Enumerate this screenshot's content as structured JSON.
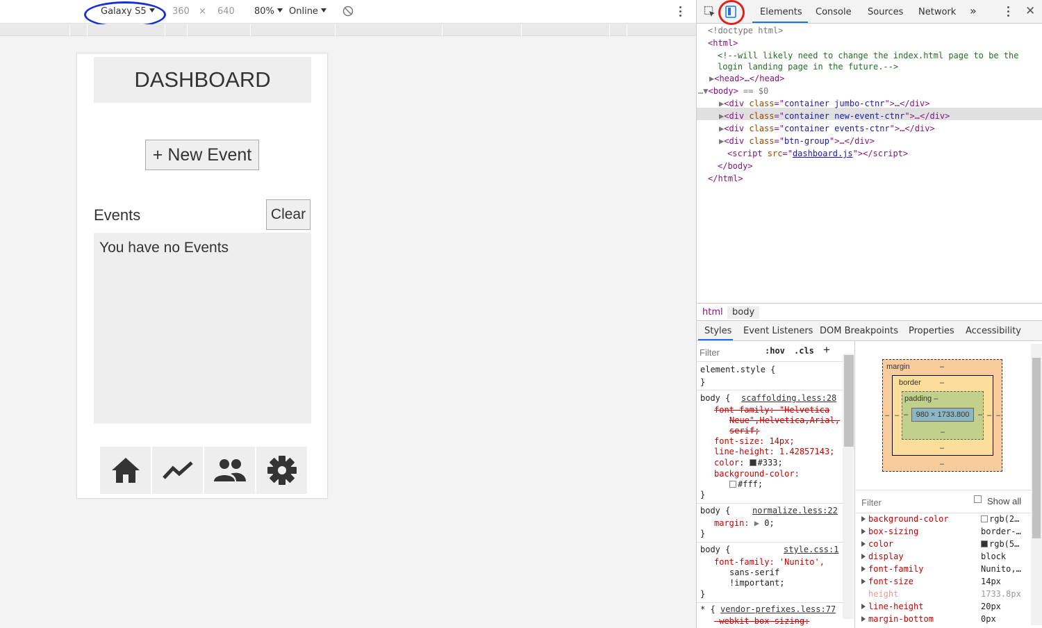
{
  "device_toolbar": {
    "device_name": "Galaxy S5",
    "width": "360",
    "times": "×",
    "height": "640",
    "zoom": "80%",
    "network": "Online"
  },
  "page": {
    "title": "DASHBOARD",
    "new_event_label": "+ New Event",
    "events_label": "Events",
    "clear_label": "Clear",
    "empty_message": "You have no Events"
  },
  "devtools": {
    "tabs": [
      "Elements",
      "Console",
      "Sources",
      "Network"
    ],
    "more": "»",
    "dom": {
      "doctype": "<!doctype html>",
      "html_open": "<html>",
      "comment_1": "<!--will likely need to change the index.html page to be the",
      "comment_2": "login landing page in the future.-->",
      "head": "<head>…</head>",
      "body_open": "<body>",
      "body_eq": " == $0",
      "divs": [
        {
          "class": "container jumbo-ctnr"
        },
        {
          "class": "container new-event-ctnr"
        },
        {
          "class": "container events-ctnr"
        },
        {
          "class": "btn-group"
        }
      ],
      "script_src": "dashboard.js",
      "body_close": "</body>",
      "html_close": "</html>"
    },
    "breadcrumbs": [
      "html",
      "body"
    ],
    "sub_tabs": [
      "Styles",
      "Event Listeners",
      "DOM Breakpoints",
      "Properties",
      "Accessibility"
    ],
    "styles": {
      "filter_placeholder": "Filter",
      "hov": ":hov",
      "cls": ".cls",
      "plus": "+",
      "element_style": "element.style {",
      "rules": [
        {
          "selector": "body {",
          "source": "scaffolding.less:28"
        },
        {
          "selector": "body {",
          "source": "normalize.less:22"
        },
        {
          "selector": "body {",
          "source": "style.css:1"
        },
        {
          "selector": "* {",
          "source": "vendor-prefixes.less:77"
        }
      ],
      "lines": {
        "ff_strike_1": "font-family: \"Helvetica",
        "ff_strike_2": "Neue\",Helvetica,Arial,",
        "ff_strike_3": "serif;",
        "font_size": "font-size: 14px;",
        "line_height": "line-height: 1.42857143;",
        "color": "#333;",
        "bg_color": "background-color:",
        "bg_val": "#fff;",
        "margin": "margin:",
        "margin_val": "0;",
        "ff2": "font-family: 'Nunito',",
        "ff2_b": "sans-serif",
        "ff2_c": "!important;",
        "webkit": "-webkit-box-sizing:",
        "brace": "}"
      }
    },
    "box_model": {
      "margin": "margin",
      "border": "border",
      "padding": "padding",
      "content": "980 × 1733.800",
      "dash": "–"
    },
    "computed": {
      "filter_placeholder": "Filter",
      "show_all": "Show all",
      "props": [
        {
          "name": "background-color",
          "value": "rgb(2…"
        },
        {
          "name": "box-sizing",
          "value": "border-…"
        },
        {
          "name": "color",
          "value": "rgb(5…"
        },
        {
          "name": "display",
          "value": "block"
        },
        {
          "name": "font-family",
          "value": "Nunito,…"
        },
        {
          "name": "font-size",
          "value": "14px"
        },
        {
          "name": "height",
          "value": "1733.8px"
        },
        {
          "name": "line-height",
          "value": "20px"
        },
        {
          "name": "margin-bottom",
          "value": "0px"
        }
      ]
    }
  },
  "colors": {
    "annotation_blue": "#1a2fd1",
    "annotation_red": "#e0201c",
    "tab_active": "#1a73e8"
  }
}
